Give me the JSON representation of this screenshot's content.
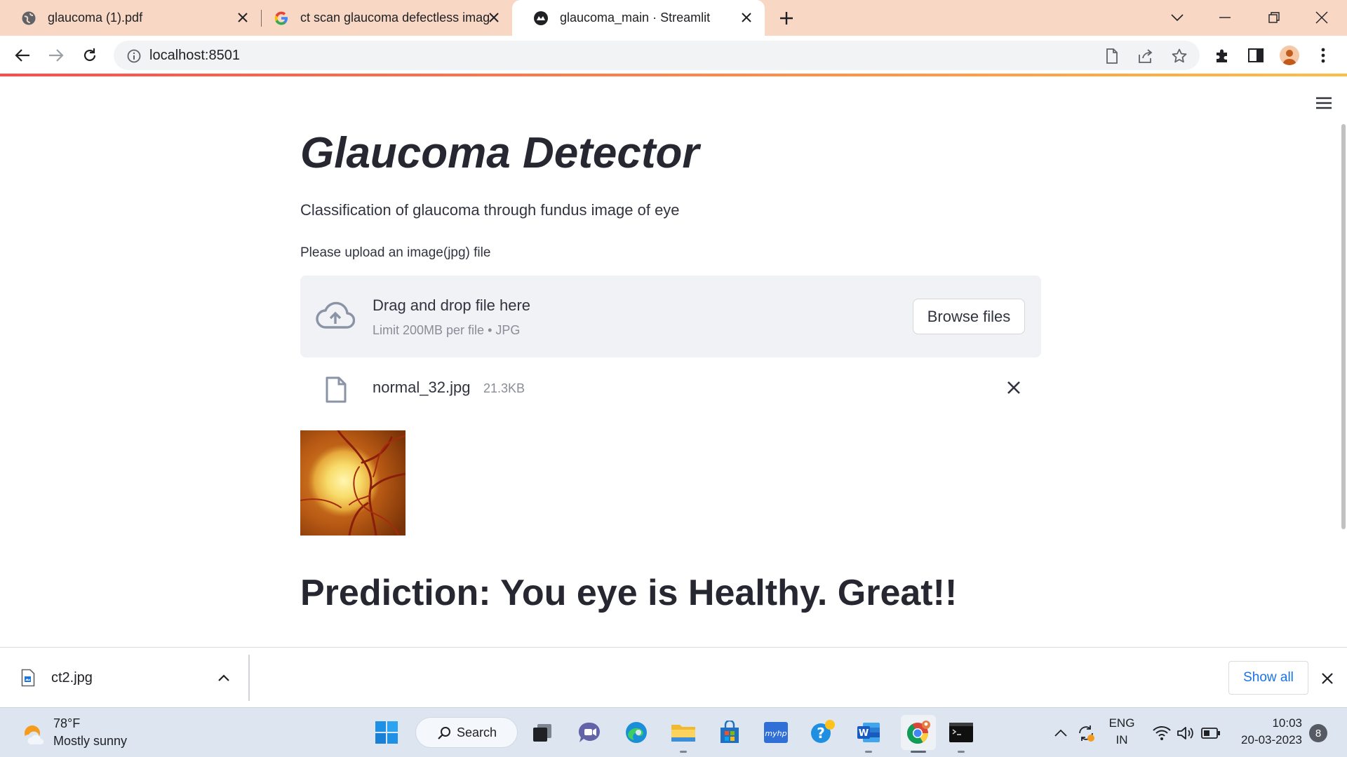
{
  "browser": {
    "tabs": [
      {
        "title": "glaucoma (1).pdf",
        "icon": "globe-icon",
        "active": false
      },
      {
        "title": "ct scan glaucoma defectless imag",
        "icon": "google-icon",
        "active": false
      },
      {
        "title": "glaucoma_main · Streamlit",
        "icon": "streamlit-icon",
        "active": true
      }
    ],
    "url": "localhost:8501"
  },
  "page": {
    "title": "Glaucoma Detector",
    "subtitle": "Classification of glaucoma through fundus image of eye",
    "upload_label": "Please upload an image(jpg) file",
    "dropzone": {
      "title": "Drag and drop file here",
      "limit": "Limit 200MB per file • JPG",
      "browse_label": "Browse files"
    },
    "uploaded_file": {
      "name": "normal_32.jpg",
      "size": "21.3KB"
    },
    "prediction": "Prediction: You eye is Healthy. Great!!"
  },
  "downloads": {
    "item": "ct2.jpg",
    "show_all": "Show all"
  },
  "taskbar": {
    "weather_temp": "78°F",
    "weather_desc": "Mostly sunny",
    "search_label": "Search",
    "lang_line1": "ENG",
    "lang_line2": "IN",
    "time": "10:03",
    "date": "20-03-2023",
    "notifications": "8"
  },
  "colors": {
    "tabstrip": "#f8d7c5",
    "streamlit_accent_start": "#ff4b4b",
    "streamlit_accent_end": "#ffbd45",
    "dropzone_bg": "#f0f2f6",
    "link_blue": "#1a73e8"
  }
}
